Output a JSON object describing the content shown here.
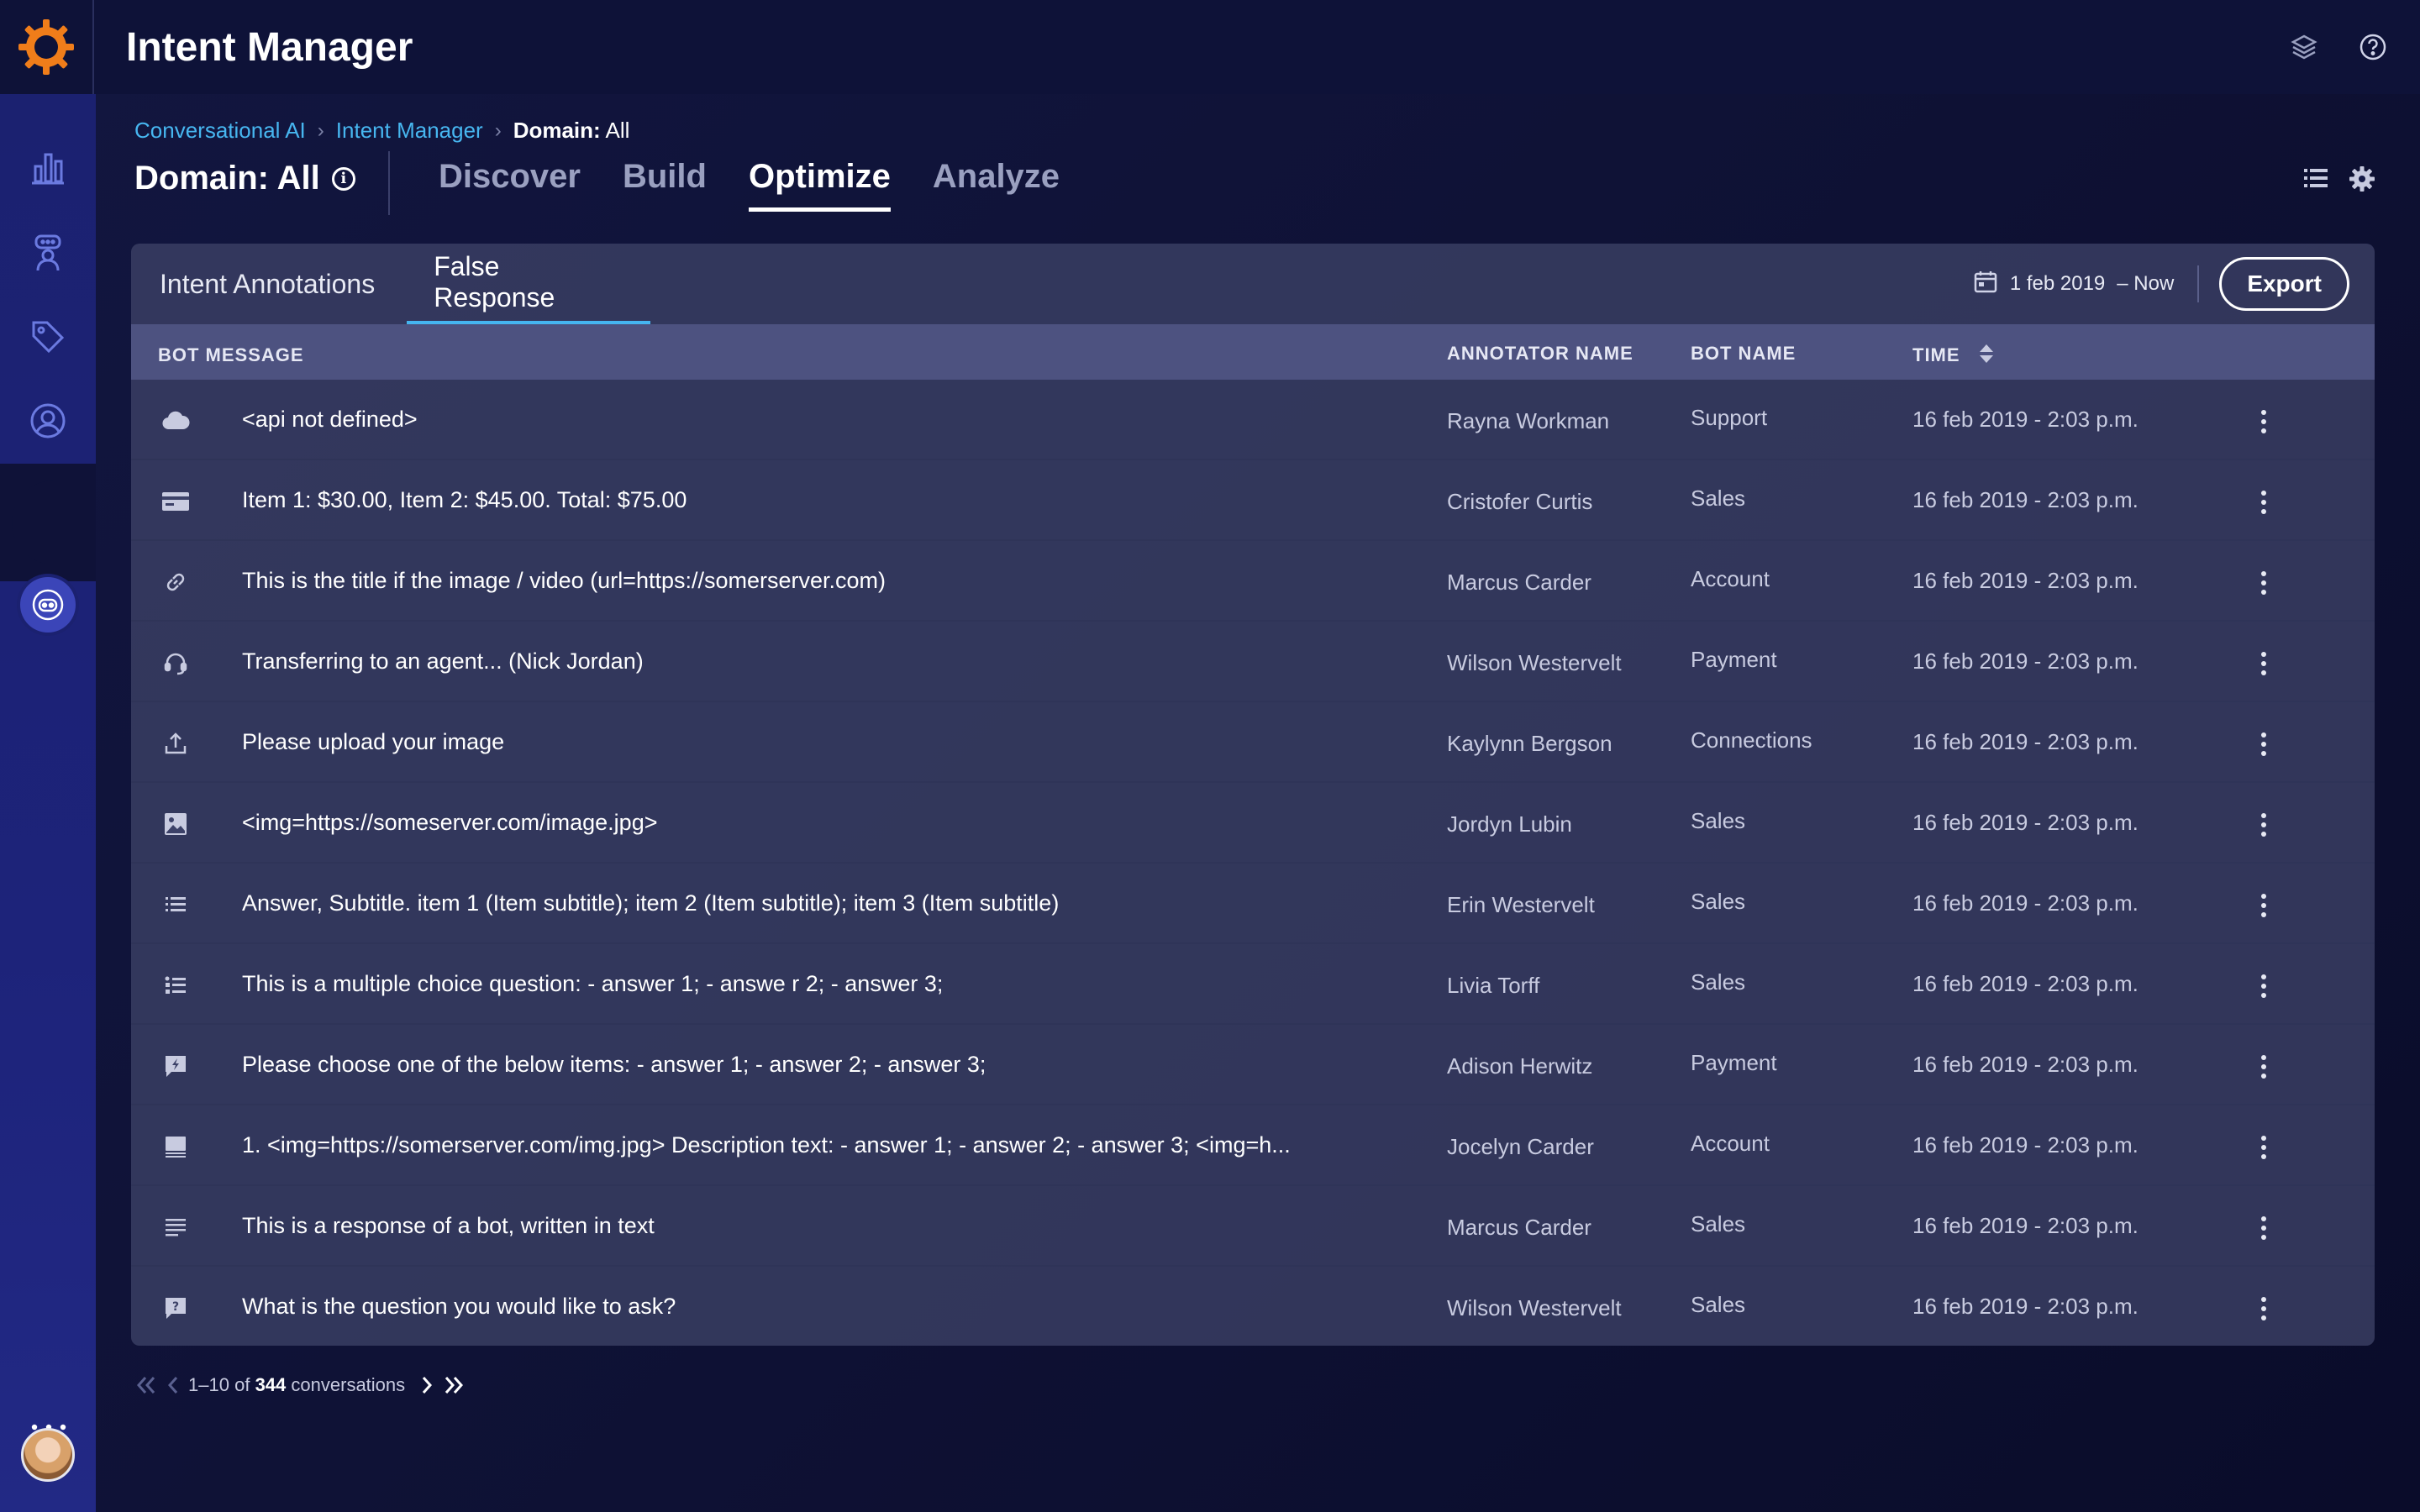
{
  "app": {
    "title": "Intent Manager"
  },
  "breadcrumb": {
    "items": [
      "Conversational AI",
      "Intent Manager"
    ],
    "current_prefix": "Domain:",
    "current_value": "All"
  },
  "page": {
    "title": "Domain: All",
    "tabs": [
      "Discover",
      "Build",
      "Optimize",
      "Analyze"
    ],
    "active_tab": "Optimize"
  },
  "panel": {
    "tabs": [
      "Intent Annotations",
      "False Response"
    ],
    "active_tab": "False Response",
    "date_range": {
      "from": "1 feb 2019",
      "to": "– Now"
    },
    "export_label": "Export"
  },
  "table": {
    "columns": [
      "BOT MESSAGE",
      "ANNOTATOR NAME",
      "BOT NAME",
      "TIME"
    ],
    "rows": [
      {
        "icon": "cloud-icon",
        "message": "<api not defined>",
        "annotator": "Rayna Workman",
        "bot": "Support",
        "time": "16 feb 2019 - 2:03 p.m."
      },
      {
        "icon": "card-icon",
        "message": "Item 1: $30.00, Item 2: $45.00. Total: $75.00",
        "annotator": "Cristofer Curtis",
        "bot": "Sales",
        "time": "16 feb 2019 - 2:03 p.m."
      },
      {
        "icon": "link-icon",
        "message": "This is the title if the image / video (url=https://somerserver.com)",
        "annotator": "Marcus Carder",
        "bot": "Account",
        "time": "16 feb 2019 - 2:03 p.m."
      },
      {
        "icon": "headset-icon",
        "message": "Transferring to an agent... (Nick Jordan)",
        "annotator": "Wilson Westervelt",
        "bot": "Payment",
        "time": "16 feb 2019 - 2:03 p.m."
      },
      {
        "icon": "upload-icon",
        "message": "Please upload your image",
        "annotator": "Kaylynn Bergson",
        "bot": "Connections",
        "time": "16 feb 2019 - 2:03 p.m."
      },
      {
        "icon": "image-icon",
        "message": "<img=https://someserver.com/image.jpg>",
        "annotator": "Jordyn Lubin",
        "bot": "Sales",
        "time": "16 feb 2019 - 2:03 p.m."
      },
      {
        "icon": "list-icon",
        "message": "Answer, Subtitle. item 1 (Item subtitle); item 2 (Item subtitle); item 3 (Item subtitle)",
        "annotator": "Erin Westervelt",
        "bot": "Sales",
        "time": "16 feb 2019 - 2:03 p.m."
      },
      {
        "icon": "checklist-icon",
        "message": "This is a multiple choice question: - answer 1; - answe r 2; - answer 3;",
        "annotator": "Livia Torff",
        "bot": "Sales",
        "time": "16 feb 2019 - 2:03 p.m."
      },
      {
        "icon": "quick-reply-icon",
        "message": "Please choose one of the below items: - answer 1; - answer 2; - answer 3;",
        "annotator": "Adison Herwitz",
        "bot": "Payment",
        "time": "16 feb 2019 - 2:03 p.m."
      },
      {
        "icon": "carousel-icon",
        "message": "1. <img=https://somerserver.com/img.jpg> Description text: - answer 1; - answer 2; - answer 3;  <img=h...",
        "annotator": "Jocelyn Carder",
        "bot": "Account",
        "time": "16 feb 2019 - 2:03 p.m."
      },
      {
        "icon": "text-icon",
        "message": "This is a response of a bot, written in text",
        "annotator": "Marcus Carder",
        "bot": "Sales",
        "time": "16 feb 2019 - 2:03 p.m."
      },
      {
        "icon": "question-icon",
        "message": "What is the question you would like to ask?",
        "annotator": "Wilson Westervelt",
        "bot": "Sales",
        "time": "16 feb 2019 - 2:03 p.m."
      }
    ]
  },
  "pagination": {
    "range": "1–10",
    "of": "of",
    "total": "344",
    "unit": "conversations"
  },
  "colors": {
    "accent": "#47b6f0",
    "brand": "#f07d1a",
    "sidebar": "#1d237a",
    "background": "#0f1236"
  }
}
